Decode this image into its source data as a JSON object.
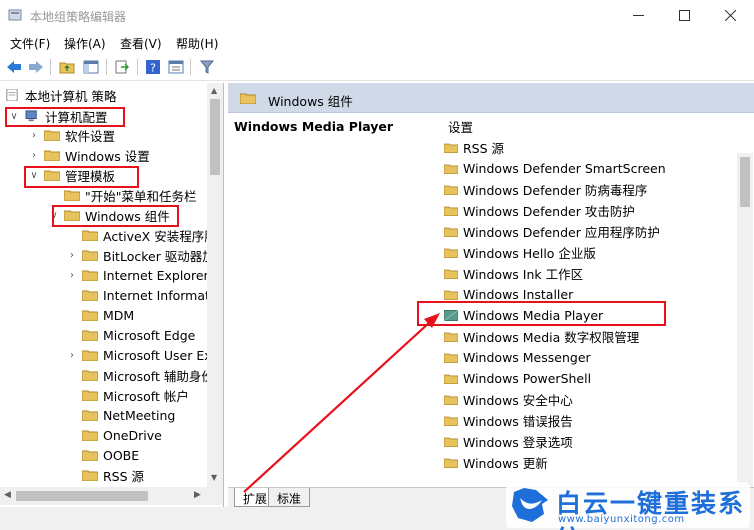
{
  "window": {
    "title": "本地组策略编辑器"
  },
  "menu": [
    "文件(F)",
    "操作(A)",
    "查看(V)",
    "帮助(H)"
  ],
  "tree": {
    "root": "本地计算机 策略",
    "computer_config": "计算机配置",
    "software_settings": "软件设置",
    "windows_settings": "Windows 设置",
    "admin_templates": "管理模板",
    "start_menu": "\"开始\"菜单和任务栏",
    "windows_components": "Windows 组件",
    "components": [
      "ActiveX 安装程序服",
      "BitLocker 驱动器加",
      "Internet Explorer",
      "Internet Informati",
      "MDM",
      "Microsoft Edge",
      "Microsoft User Ex",
      "Microsoft 辅助身份",
      "Microsoft 帐户",
      "NetMeeting",
      "OneDrive",
      "OOBE",
      "RSS 源"
    ]
  },
  "right": {
    "header": "Windows 组件",
    "selected_title": "Windows Media Player",
    "list_header": "设置",
    "items": [
      "RSS 源",
      "Windows Defender SmartScreen",
      "Windows Defender 防病毒程序",
      "Windows Defender 攻击防护",
      "Windows Defender 应用程序防护",
      "Windows Hello 企业版",
      "Windows Ink 工作区",
      "Windows Installer",
      "Windows Media Player",
      "Windows Media 数字权限管理",
      "Windows Messenger",
      "Windows PowerShell",
      "Windows 安全中心",
      "Windows 错误报告",
      "Windows 登录选项",
      "Windows 更新"
    ]
  },
  "tabs": [
    "扩展",
    "标准"
  ],
  "watermark": {
    "title": "白云一键重装系统",
    "url": "www.baiyunxitong.com"
  },
  "colors": {
    "highlight": "#e8101a",
    "folder": "#e8c25c",
    "brand": "#1e6fd9"
  }
}
